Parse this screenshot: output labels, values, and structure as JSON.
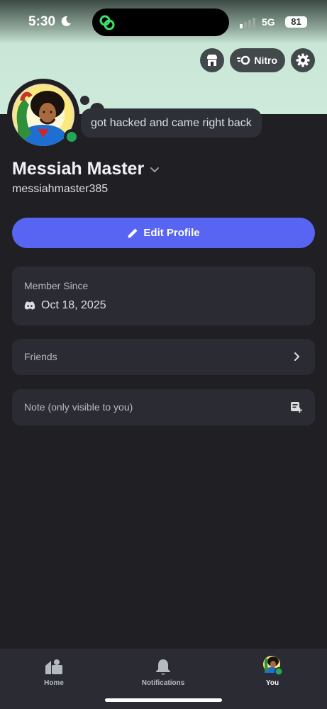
{
  "status_bar": {
    "time": "5:30",
    "network": "5G",
    "battery": "81"
  },
  "header": {
    "shop_icon": "shop-icon",
    "nitro_label": "Nitro",
    "settings_icon": "gear-icon"
  },
  "profile": {
    "custom_status": "got hacked and came right back",
    "display_name": "Messiah Master",
    "username": "messiahmaster385",
    "presence": "online",
    "edit_profile_label": "Edit Profile"
  },
  "member_since": {
    "label": "Member Since",
    "date": "Oct 18, 2025"
  },
  "friends": {
    "label": "Friends"
  },
  "note": {
    "placeholder": "Note (only visible to you)"
  },
  "bottom_nav": {
    "items": [
      {
        "label": "Home",
        "icon": "home-icon"
      },
      {
        "label": "Notifications",
        "icon": "bell-icon"
      },
      {
        "label": "You",
        "icon": "avatar-icon",
        "active": true
      }
    ]
  },
  "colors": {
    "accent": "#5865f2",
    "online": "#23a55a",
    "background": "#1f1f24",
    "card": "#2b2c33",
    "banner": "#cdeadb"
  }
}
